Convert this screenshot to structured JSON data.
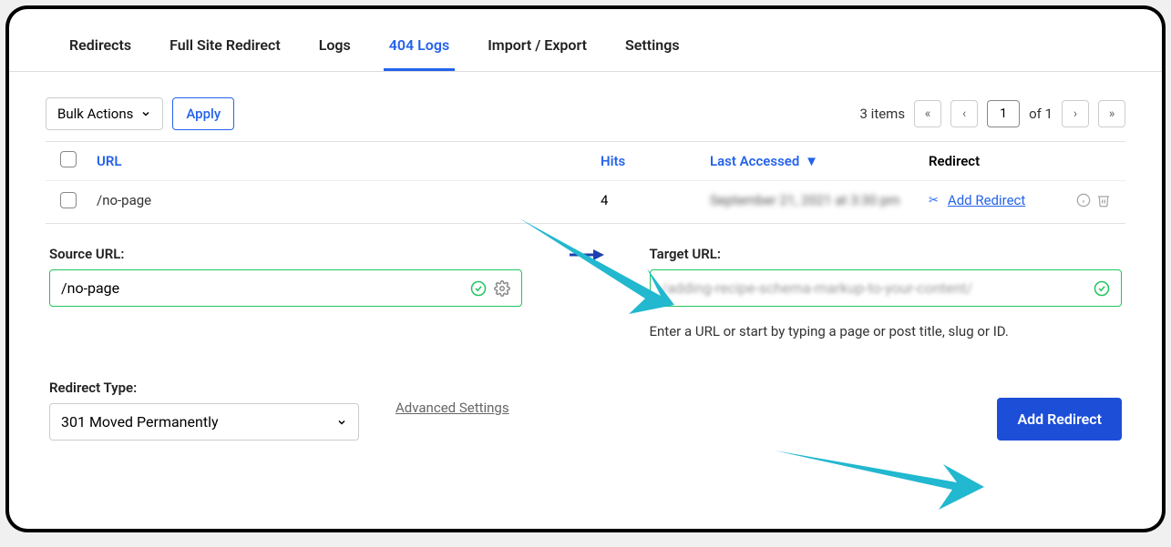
{
  "tabs": [
    "Redirects",
    "Full Site Redirect",
    "Logs",
    "404 Logs",
    "Import / Export",
    "Settings"
  ],
  "active_tab_index": 3,
  "bulk": {
    "label": "Bulk Actions",
    "apply": "Apply"
  },
  "pagination": {
    "count_text": "3 items",
    "page": "1",
    "of_text": "of 1"
  },
  "columns": {
    "url": "URL",
    "hits": "Hits",
    "last": "Last Accessed",
    "redirect": "Redirect"
  },
  "rows": [
    {
      "url": "/no-page",
      "hits": "4",
      "last": "September 21, 2021 at 3:30 pm",
      "action": "Add Redirect"
    }
  ],
  "form": {
    "source_label": "Source URL:",
    "source_value": "/no-page",
    "target_label": "Target URL:",
    "target_value": "/adding-recipe-schema-markup-to-your-content/",
    "helper": "Enter a URL or start by typing a page or post title, slug or ID.",
    "redirect_type_label": "Redirect Type:",
    "redirect_type_value": "301 Moved Permanently",
    "advanced": "Advanced Settings",
    "submit": "Add Redirect"
  }
}
